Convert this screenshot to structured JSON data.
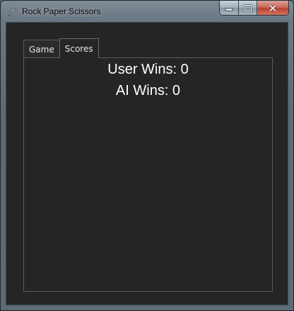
{
  "window": {
    "title": "Rock Paper Scissors",
    "icon": "feather-icon"
  },
  "caption": {
    "minimize_icon": "minimize-icon",
    "maximize_icon": "maximize-icon",
    "close_icon": "close-icon"
  },
  "tabs": [
    {
      "label": "Game",
      "selected": false
    },
    {
      "label": "Scores",
      "selected": true
    }
  ],
  "scores": {
    "user_wins": "User Wins: 0",
    "ai_wins": "AI Wins: 0"
  },
  "colors": {
    "background": "#252525",
    "text": "#ffffff",
    "close_button": "#c7503d"
  }
}
